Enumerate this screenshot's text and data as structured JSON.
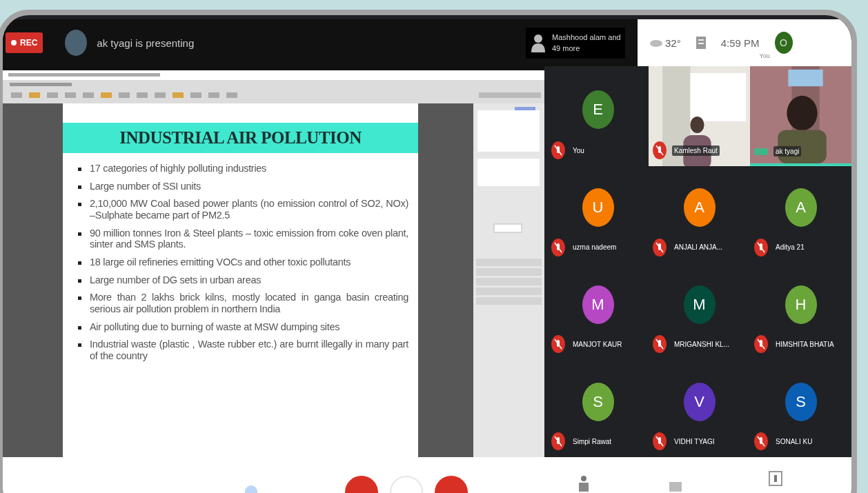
{
  "top_bar": {
    "rec_label": "REC",
    "presenter_text": "ak tyagi is presenting",
    "participants_text": "Mashhood alam and 49 more"
  },
  "status": {
    "temperature": "32°",
    "time": "4:59 PM",
    "self_label": "You",
    "self_initial": "O"
  },
  "slide": {
    "title": "INDUSTRIAL AIR POLLUTION",
    "bullets": [
      "17 categories of highly polluting industries",
      "Large number of SSI units",
      "2,10,000 MW Coal based power plants (no emission control of SO2, NOx) –Sulphate became part of PM2.5",
      "90 million tonnes Iron & Steel plants – toxic emission from coke oven plant, sinter and SMS plants.",
      "18 large oil refineries emitting VOCs and other toxic pollutants",
      "Large number of DG sets in urban areas",
      "More than 2 lakhs brick kilns, mostly located in ganga basin creating serious air pollution problem in northern India",
      "Air polluting due to burning of waste at MSW dumping sites",
      "Industrial waste (plastic , Waste rubber etc.) are burnt illegally in many part of the country"
    ]
  },
  "tiles": [
    {
      "kind": "avatar",
      "name": "You",
      "initial": "E",
      "color": "#3d7f2e",
      "muted": true,
      "speaking": false
    },
    {
      "kind": "video",
      "name": "Kamlesh Raut",
      "muted": true,
      "speaking": false
    },
    {
      "kind": "video",
      "name": "ak tyagi",
      "muted": false,
      "speaking": true
    },
    {
      "kind": "avatar",
      "name": "uzma nadeem",
      "initial": "U",
      "color": "#f57c00",
      "muted": true,
      "speaking": false
    },
    {
      "kind": "avatar",
      "name": "ANJALI ANJA...",
      "initial": "A",
      "color": "#f57c00",
      "muted": true,
      "speaking": false
    },
    {
      "kind": "avatar",
      "name": "Aditya 21",
      "initial": "A",
      "color": "#6aa53a",
      "muted": true,
      "speaking": false
    },
    {
      "kind": "avatar",
      "name": "MANJOT KAUR",
      "initial": "M",
      "color": "#b648c4",
      "muted": true,
      "speaking": false
    },
    {
      "kind": "avatar",
      "name": "MRIGANSHI KL...",
      "initial": "M",
      "color": "#044d3c",
      "muted": true,
      "speaking": false
    },
    {
      "kind": "avatar",
      "name": "HIMSHITA BHATIA",
      "initial": "H",
      "color": "#6aa53a",
      "muted": true,
      "speaking": false
    },
    {
      "kind": "avatar",
      "name": "Simpi Rawat",
      "initial": "S",
      "color": "#6aa53a",
      "muted": true,
      "speaking": false
    },
    {
      "kind": "avatar",
      "name": "VIDHI TYAGI",
      "initial": "V",
      "color": "#5b33b8",
      "muted": true,
      "speaking": false
    },
    {
      "kind": "avatar",
      "name": "SONALI KU",
      "initial": "S",
      "color": "#0a5fb4",
      "muted": true,
      "speaking": false
    }
  ]
}
